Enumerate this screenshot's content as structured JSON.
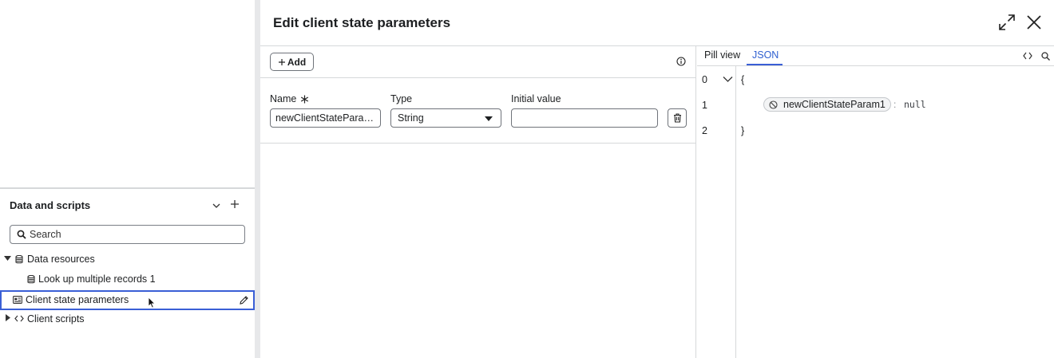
{
  "left_panel": {
    "section_title": "Data and scripts",
    "search_placeholder": "Search",
    "tree": [
      {
        "label": "Data resources",
        "expanded": true,
        "icon": "database-icon"
      },
      {
        "label": "Look up multiple records 1",
        "icon": "database-icon"
      },
      {
        "label": "Client state parameters",
        "selected": true,
        "icon": "client-state-icon"
      },
      {
        "label": "Client scripts",
        "expanded": false,
        "icon": "code-icon"
      }
    ]
  },
  "dialog": {
    "title": "Edit client state parameters",
    "add_label": "Add",
    "fields": {
      "name_label": "Name",
      "name_value": "newClientStateParam1",
      "type_label": "Type",
      "type_value": "String",
      "initial_label": "Initial value",
      "initial_value": ""
    },
    "json_view": {
      "tabs": [
        "Pill view",
        "JSON"
      ],
      "active_tab": "JSON",
      "line_numbers": [
        "0",
        "1",
        "2"
      ],
      "open_brace": "{",
      "close_brace": "}",
      "pill_label": "newClientStateParam1",
      "colon": ":",
      "value": "null"
    }
  },
  "colors": {
    "accent": "#3a5fd6",
    "border": "#d6d8da"
  }
}
